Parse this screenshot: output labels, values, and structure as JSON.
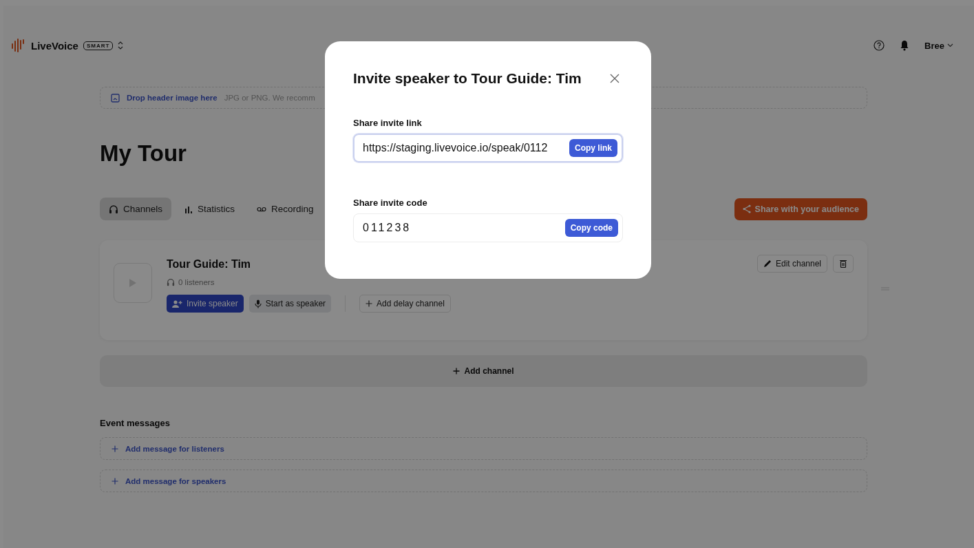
{
  "app": {
    "name": "LiveVoice",
    "plan_badge": "SMART"
  },
  "user": {
    "name": "Bree"
  },
  "header_upload": {
    "link": "Drop header image here",
    "hint": "JPG or PNG. We recomm"
  },
  "event": {
    "title": "My Tour"
  },
  "tabs": [
    {
      "label": "Channels",
      "kind": "headphones",
      "selected": true
    },
    {
      "label": "Statistics",
      "kind": "bars",
      "selected": false
    },
    {
      "label": "Recording",
      "kind": "tape",
      "selected": false
    }
  ],
  "share_button": "Share with your audience",
  "channels": [
    {
      "name": "Tour Guide: Tim",
      "listeners": "0 listeners",
      "invite": "Invite speaker",
      "start": "Start as speaker",
      "delay": "Add delay channel",
      "edit": "Edit channel"
    }
  ],
  "add_channel": "Add channel",
  "event_messages": {
    "title": "Event messages",
    "items": [
      "Add message for listeners",
      "Add message for speakers"
    ]
  },
  "modal": {
    "title": "Invite speaker to Tour Guide: Tim",
    "link_label": "Share invite link",
    "link_value": "https://staging.livevoice.io/speak/0112",
    "copy_link": "Copy link",
    "code_label": "Share invite code",
    "code_value": "011238",
    "copy_code": "Copy code"
  }
}
